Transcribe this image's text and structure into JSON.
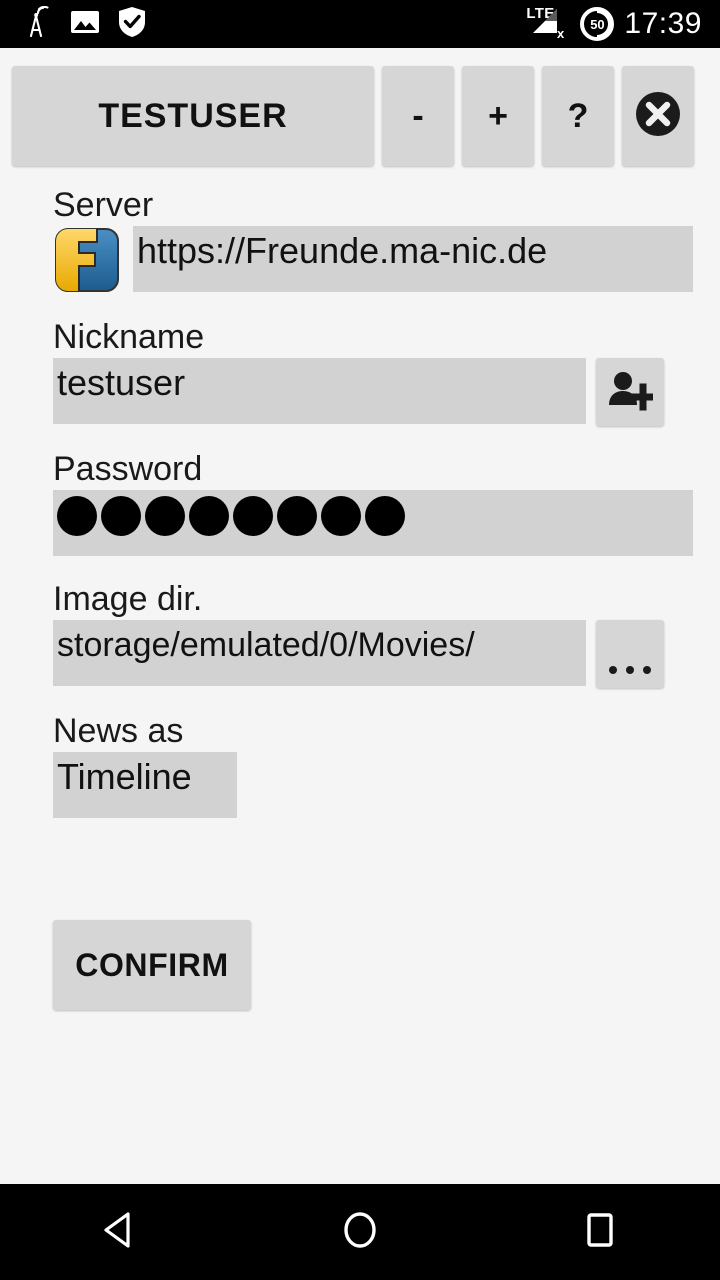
{
  "status_bar": {
    "left_icons": [
      "broadcast-antenna-icon",
      "image-icon",
      "shield-check-icon"
    ],
    "network_label": "LTE",
    "network_state": "x",
    "battery_level": "50",
    "time": "17:39"
  },
  "toolbar": {
    "account_label": "TESTUSER",
    "decrease_label": "-",
    "increase_label": "+",
    "help_label": "?",
    "close_icon": "close-circle-icon"
  },
  "form": {
    "server": {
      "label": "Server",
      "icon": "friendica-logo-icon",
      "value": "https://Freunde.ma-nic.de"
    },
    "nickname": {
      "label": "Nickname",
      "value": "testuser",
      "action_icon": "add-user-icon"
    },
    "password": {
      "label": "Password",
      "masked_char_count": 8,
      "value": "●●●●●●●●"
    },
    "image_dir": {
      "label": "Image dir.",
      "value": "storage/emulated/0/Movies/",
      "browse_label": "..."
    },
    "news_as": {
      "label": "News as",
      "value": "Timeline",
      "options": [
        "Timeline"
      ]
    }
  },
  "confirm_button": {
    "label": "CONFIRM"
  },
  "nav_bar": {
    "back_icon": "back-triangle-icon",
    "home_icon": "home-circle-icon",
    "recents_icon": "recents-square-icon"
  },
  "colors": {
    "page_background": "#f4f5f4",
    "field_background": "#d2d2d2",
    "button_background": "#d6d6d6",
    "system_bar": "#000000",
    "text": "#111111",
    "logo_yellow": "#f6c game",
    "logo_blue": "#2b6ca3"
  }
}
